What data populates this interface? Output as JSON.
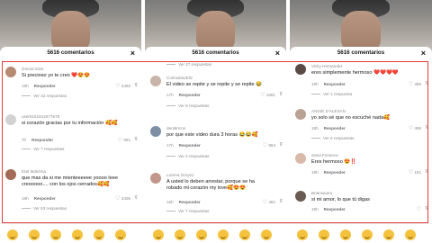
{
  "panels": [
    {
      "title": "5616 comentarios",
      "comments": [
        {
          "user": "Grecia Soto",
          "text": "Si precioso yo te creo ❤️😍😍",
          "time": "19h",
          "reply": "Responder",
          "likes": "3492",
          "replies": "Ver 32 respuestas"
        },
        {
          "user": "user6151812677678",
          "text": "si corazón gracias por tu información 🥰🥰",
          "time": "7h",
          "reply": "Responder",
          "likes": "951",
          "replies": "Ver 7 respuestas"
        },
        {
          "user": "Itzel ledezma",
          "text": "que mas da si me mienteeeeee yoooo leee creooooo.... con los ojos cerrados🥰🥰",
          "time": "19h",
          "reply": "Responder",
          "likes": "3409",
          "replies": "Ver 63 respuestas"
        }
      ]
    },
    {
      "title": "5616 comentarios",
      "top_replies": "Ver 27 respuestas",
      "comments": [
        {
          "user": "CorinaDavEliz",
          "text": "El video se repite y se repite y se repite 😂",
          "time": "17h",
          "reply": "Responder",
          "likes": "1681",
          "replies": "Ver 8 respuestas"
        },
        {
          "user": "deni8ricon",
          "text": "por que este video dura 3 horas 😂😂🥰",
          "time": "17h",
          "reply": "Responder",
          "likes": "864",
          "replies": "Ver 4 respuestas"
        },
        {
          "user": "Lorena Grnyez",
          "text": "A usted lo deben arrestar, porque se ha robado mi corazón my love🥰😍😍",
          "time": "16h",
          "reply": "Responder",
          "likes": "462",
          "replies": "Ver 7 respuestas"
        }
      ]
    },
    {
      "title": "5616 comentarios",
      "comments": [
        {
          "user": "Vicky Hernandez",
          "text": "eres simplemente hermoso ❤️❤️❤️❤️",
          "time": "19h",
          "reply": "Responder",
          "likes": "395",
          "replies": "Ver 1 respuesta"
        },
        {
          "user": "ANGIE D'ALESAN",
          "text": "yo solo sé que no escuché nada🥰",
          "time": "18h",
          "reply": "Responder",
          "likes": "459",
          "replies": "Ver 6 respuestas"
        },
        {
          "user": "Sarai Fonseca",
          "text": "Eres hermoso 😍‼️",
          "time": "19h",
          "reply": "Responder",
          "likes": "181",
          "replies": ""
        },
        {
          "user": "Briansauiro",
          "text": "si mi amor, lo que tú digas",
          "time": "19h",
          "reply": "Responder",
          "likes": "",
          "replies": ""
        }
      ]
    }
  ]
}
